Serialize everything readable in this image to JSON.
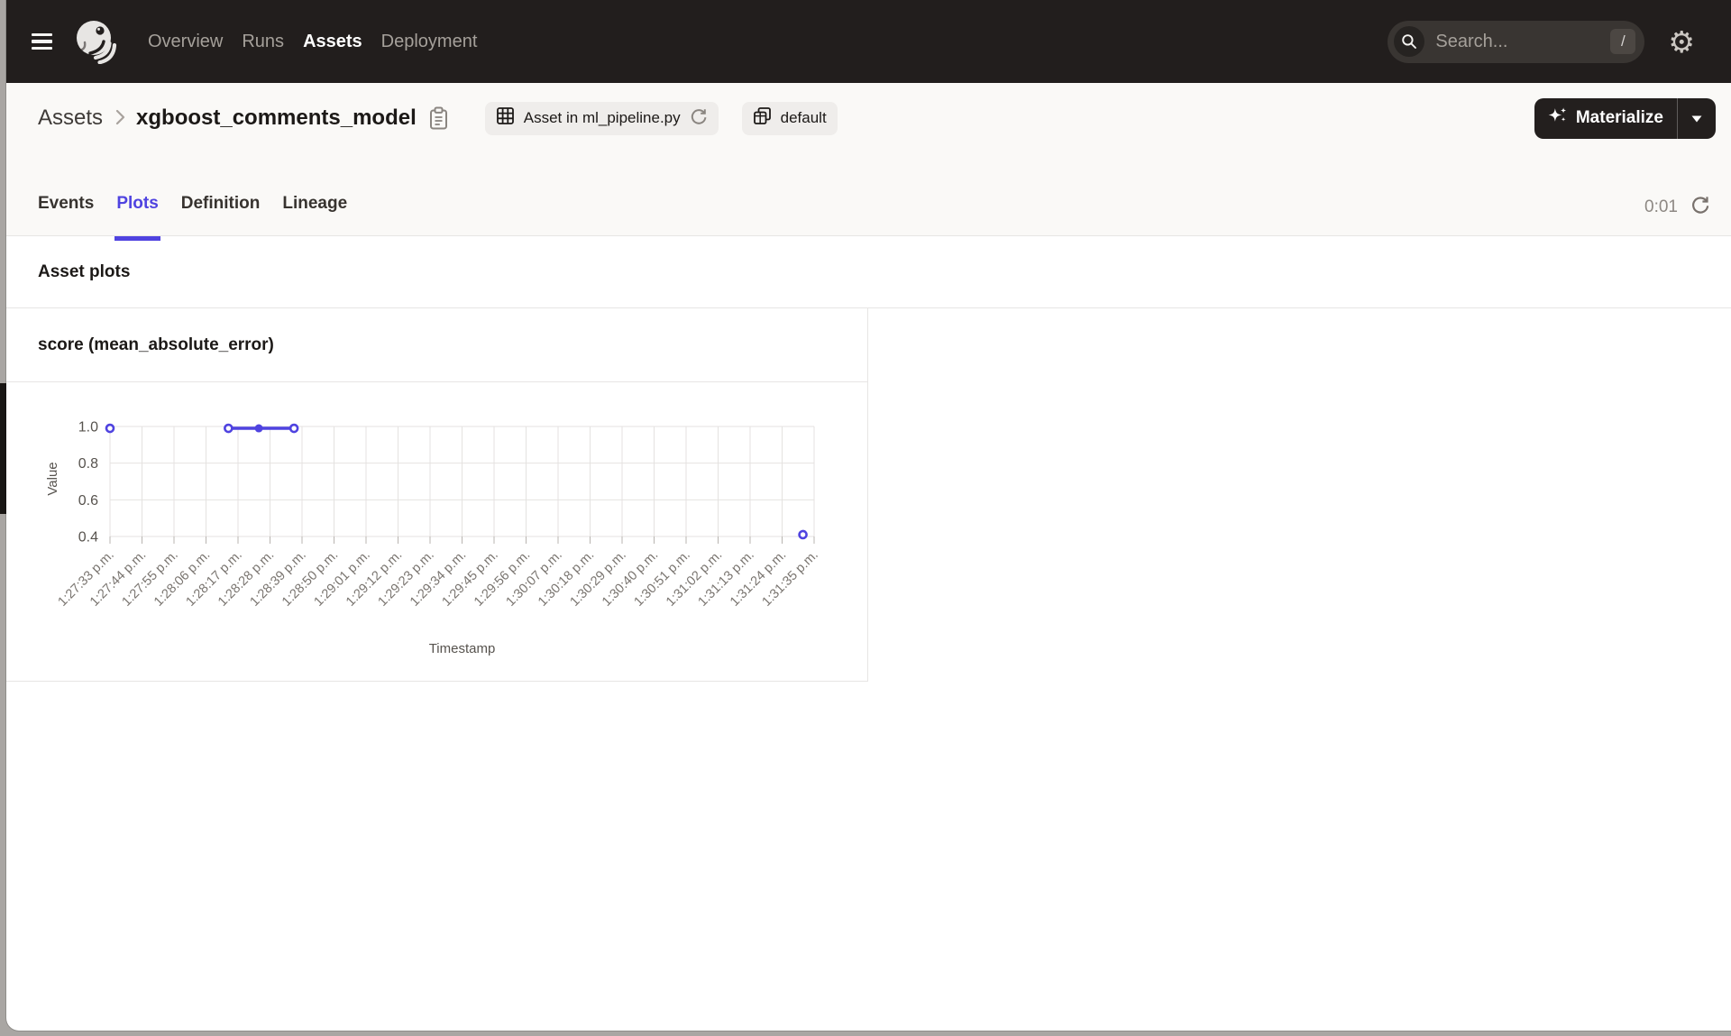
{
  "colors": {
    "accent": "#4F43E0",
    "header_bg": "#221E1D",
    "chart_line": "#4F43E0"
  },
  "header": {
    "nav": [
      {
        "label": "Overview",
        "active": false
      },
      {
        "label": "Runs",
        "active": false
      },
      {
        "label": "Assets",
        "active": true
      },
      {
        "label": "Deployment",
        "active": false
      }
    ],
    "search": {
      "placeholder": "Search...",
      "shortcut": "/"
    }
  },
  "breadcrumb": {
    "parent": "Assets",
    "current": "xgboost_comments_model"
  },
  "badges": {
    "definition": "Asset in ml_pipeline.py",
    "group": "default"
  },
  "materialize": {
    "label": "Materialize"
  },
  "tabs": [
    {
      "label": "Events",
      "active": false
    },
    {
      "label": "Plots",
      "active": true
    },
    {
      "label": "Definition",
      "active": false
    },
    {
      "label": "Lineage",
      "active": false
    }
  ],
  "refresh": {
    "countdown": "0:01"
  },
  "section_title": "Asset plots",
  "chart_data": {
    "type": "line",
    "title": "score (mean_absolute_error)",
    "xlabel": "Timestamp",
    "ylabel": "Value",
    "ylim": [
      0.4,
      1.0
    ],
    "y_ticks": [
      1.0,
      0.8,
      0.6,
      0.4
    ],
    "grid": true,
    "legend": "none",
    "x_tick_labels": [
      "1:27:33 p.m.",
      "1:27:44 p.m.",
      "1:27:55 p.m.",
      "1:28:06 p.m.",
      "1:28:17 p.m.",
      "1:28:28 p.m.",
      "1:28:39 p.m.",
      "1:28:50 p.m.",
      "1:29:01 p.m.",
      "1:29:12 p.m.",
      "1:29:23 p.m.",
      "1:29:34 p.m.",
      "1:29:45 p.m.",
      "1:29:56 p.m.",
      "1:30:07 p.m.",
      "1:30:18 p.m.",
      "1:30:29 p.m.",
      "1:30:40 p.m.",
      "1:30:51 p.m.",
      "1:31:02 p.m.",
      "1:31:13 p.m.",
      "1:31:24 p.m.",
      "1:31:35 p.m."
    ],
    "series": [
      {
        "name": "score (mean_absolute_error)",
        "points": [
          {
            "time": "1:27:33 p.m.",
            "x_tick": 0,
            "value": 0.99,
            "marker": "ring"
          },
          {
            "time": "~1:28:14 p.m.",
            "x_tick": 3.7,
            "value": 0.99,
            "marker": "ring"
          },
          {
            "time": "~1:28:25 p.m.",
            "x_tick": 4.65,
            "value": 0.99,
            "marker": "dot"
          },
          {
            "time": "~1:28:37 p.m.",
            "x_tick": 5.75,
            "value": 0.99,
            "marker": "ring"
          },
          {
            "time": "~1:31:31 p.m.",
            "x_tick": 21.65,
            "value": 0.41,
            "marker": "ring"
          }
        ],
        "connected_segments": [
          [
            1,
            2,
            3
          ]
        ]
      }
    ]
  }
}
